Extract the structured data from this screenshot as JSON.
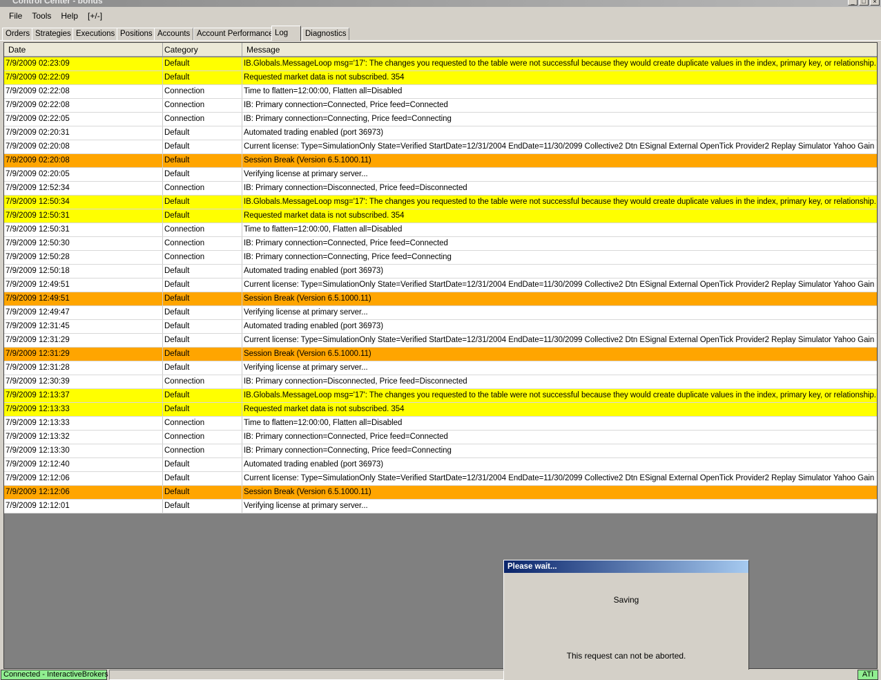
{
  "window": {
    "title": "Control Center - bonds"
  },
  "menu": [
    "File",
    "Tools",
    "Help",
    "[+/-]"
  ],
  "tabs": [
    {
      "label": "Orders"
    },
    {
      "label": "Strategies"
    },
    {
      "label": "Executions"
    },
    {
      "label": "Positions"
    },
    {
      "label": "Accounts"
    },
    {
      "label": "Account Performance"
    },
    {
      "label": "Log"
    },
    {
      "label": "Diagnostics"
    }
  ],
  "active_tab": "Log",
  "grid": {
    "columns": [
      "Date",
      "Category",
      "Message"
    ],
    "rows": [
      {
        "date": "7/9/2009 02:23:09",
        "category": "Default",
        "message": "IB.Globals.MessageLoop msg='17': The changes you requested to the table were not successful because they would create duplicate values in the index, primary key, or relationship.",
        "highlight": "yellow"
      },
      {
        "date": "7/9/2009 02:22:09",
        "category": "Default",
        "message": "Requested market data is not subscribed. 354",
        "highlight": "yellow"
      },
      {
        "date": "7/9/2009 02:22:08",
        "category": "Connection",
        "message": "Time to flatten=12:00:00, Flatten all=Disabled",
        "highlight": ""
      },
      {
        "date": "7/9/2009 02:22:08",
        "category": "Connection",
        "message": "IB: Primary connection=Connected, Price feed=Connected",
        "highlight": ""
      },
      {
        "date": "7/9/2009 02:22:05",
        "category": "Connection",
        "message": "IB: Primary connection=Connecting, Price feed=Connecting",
        "highlight": ""
      },
      {
        "date": "7/9/2009 02:20:31",
        "category": "Default",
        "message": "Automated trading enabled (port 36973)",
        "highlight": ""
      },
      {
        "date": "7/9/2009 02:20:08",
        "category": "Default",
        "message": "Current license: Type=SimulationOnly State=Verified StartDate=12/31/2004 EndDate=11/30/2099 Collective2 Dtn ESignal External OpenTick Provider2 Replay Simulator Yahoo Gain",
        "highlight": ""
      },
      {
        "date": "7/9/2009 02:20:08",
        "category": "Default",
        "message": "Session Break (Version 6.5.1000.11)",
        "highlight": "orange"
      },
      {
        "date": "7/9/2009 02:20:05",
        "category": "Default",
        "message": "Verifying license at primary server...",
        "highlight": ""
      },
      {
        "date": "7/9/2009 12:52:34",
        "category": "Connection",
        "message": "IB: Primary connection=Disconnected, Price feed=Disconnected",
        "highlight": ""
      },
      {
        "date": "7/9/2009 12:50:34",
        "category": "Default",
        "message": "IB.Globals.MessageLoop msg='17': The changes you requested to the table were not successful because they would create duplicate values in the index, primary key, or relationship.",
        "highlight": "yellow"
      },
      {
        "date": "7/9/2009 12:50:31",
        "category": "Default",
        "message": "Requested market data is not subscribed. 354",
        "highlight": "yellow"
      },
      {
        "date": "7/9/2009 12:50:31",
        "category": "Connection",
        "message": "Time to flatten=12:00:00, Flatten all=Disabled",
        "highlight": ""
      },
      {
        "date": "7/9/2009 12:50:30",
        "category": "Connection",
        "message": "IB: Primary connection=Connected, Price feed=Connected",
        "highlight": ""
      },
      {
        "date": "7/9/2009 12:50:28",
        "category": "Connection",
        "message": "IB: Primary connection=Connecting, Price feed=Connecting",
        "highlight": ""
      },
      {
        "date": "7/9/2009 12:50:18",
        "category": "Default",
        "message": "Automated trading enabled (port 36973)",
        "highlight": ""
      },
      {
        "date": "7/9/2009 12:49:51",
        "category": "Default",
        "message": "Current license: Type=SimulationOnly State=Verified StartDate=12/31/2004 EndDate=11/30/2099 Collective2 Dtn ESignal External OpenTick Provider2 Replay Simulator Yahoo Gain",
        "highlight": ""
      },
      {
        "date": "7/9/2009 12:49:51",
        "category": "Default",
        "message": "Session Break (Version 6.5.1000.11)",
        "highlight": "orange"
      },
      {
        "date": "7/9/2009 12:49:47",
        "category": "Default",
        "message": "Verifying license at primary server...",
        "highlight": ""
      },
      {
        "date": "7/9/2009 12:31:45",
        "category": "Default",
        "message": "Automated trading enabled (port 36973)",
        "highlight": ""
      },
      {
        "date": "7/9/2009 12:31:29",
        "category": "Default",
        "message": "Current license: Type=SimulationOnly State=Verified StartDate=12/31/2004 EndDate=11/30/2099 Collective2 Dtn ESignal External OpenTick Provider2 Replay Simulator Yahoo Gain",
        "highlight": ""
      },
      {
        "date": "7/9/2009 12:31:29",
        "category": "Default",
        "message": "Session Break (Version 6.5.1000.11)",
        "highlight": "orange"
      },
      {
        "date": "7/9/2009 12:31:28",
        "category": "Default",
        "message": "Verifying license at primary server...",
        "highlight": ""
      },
      {
        "date": "7/9/2009 12:30:39",
        "category": "Connection",
        "message": "IB: Primary connection=Disconnected, Price feed=Disconnected",
        "highlight": ""
      },
      {
        "date": "7/9/2009 12:13:37",
        "category": "Default",
        "message": "IB.Globals.MessageLoop msg='17': The changes you requested to the table were not successful because they would create duplicate values in the index, primary key, or relationship.",
        "highlight": "yellow"
      },
      {
        "date": "7/9/2009 12:13:33",
        "category": "Default",
        "message": "Requested market data is not subscribed. 354",
        "highlight": "yellow"
      },
      {
        "date": "7/9/2009 12:13:33",
        "category": "Connection",
        "message": "Time to flatten=12:00:00, Flatten all=Disabled",
        "highlight": ""
      },
      {
        "date": "7/9/2009 12:13:32",
        "category": "Connection",
        "message": "IB: Primary connection=Connected, Price feed=Connected",
        "highlight": ""
      },
      {
        "date": "7/9/2009 12:13:30",
        "category": "Connection",
        "message": "IB: Primary connection=Connecting, Price feed=Connecting",
        "highlight": ""
      },
      {
        "date": "7/9/2009 12:12:40",
        "category": "Default",
        "message": "Automated trading enabled (port 36973)",
        "highlight": ""
      },
      {
        "date": "7/9/2009 12:12:06",
        "category": "Default",
        "message": "Current license: Type=SimulationOnly State=Verified StartDate=12/31/2004 EndDate=11/30/2099 Collective2 Dtn ESignal External OpenTick Provider2 Replay Simulator Yahoo Gain",
        "highlight": ""
      },
      {
        "date": "7/9/2009 12:12:06",
        "category": "Default",
        "message": "Session Break (Version 6.5.1000.11)",
        "highlight": "orange"
      },
      {
        "date": "7/9/2009 12:12:01",
        "category": "Default",
        "message": "Verifying license at primary server...",
        "highlight": ""
      }
    ]
  },
  "colors": {
    "warning_row": "#ffff00",
    "session_break_row": "#ffa500",
    "status_ok": "#90ee90"
  },
  "dialog": {
    "title": "Please wait...",
    "status": "Saving",
    "note": "This request can not be aborted."
  },
  "statusbar": {
    "connection": "Connected - InteractiveBrokers",
    "right_badge": "ATI"
  }
}
